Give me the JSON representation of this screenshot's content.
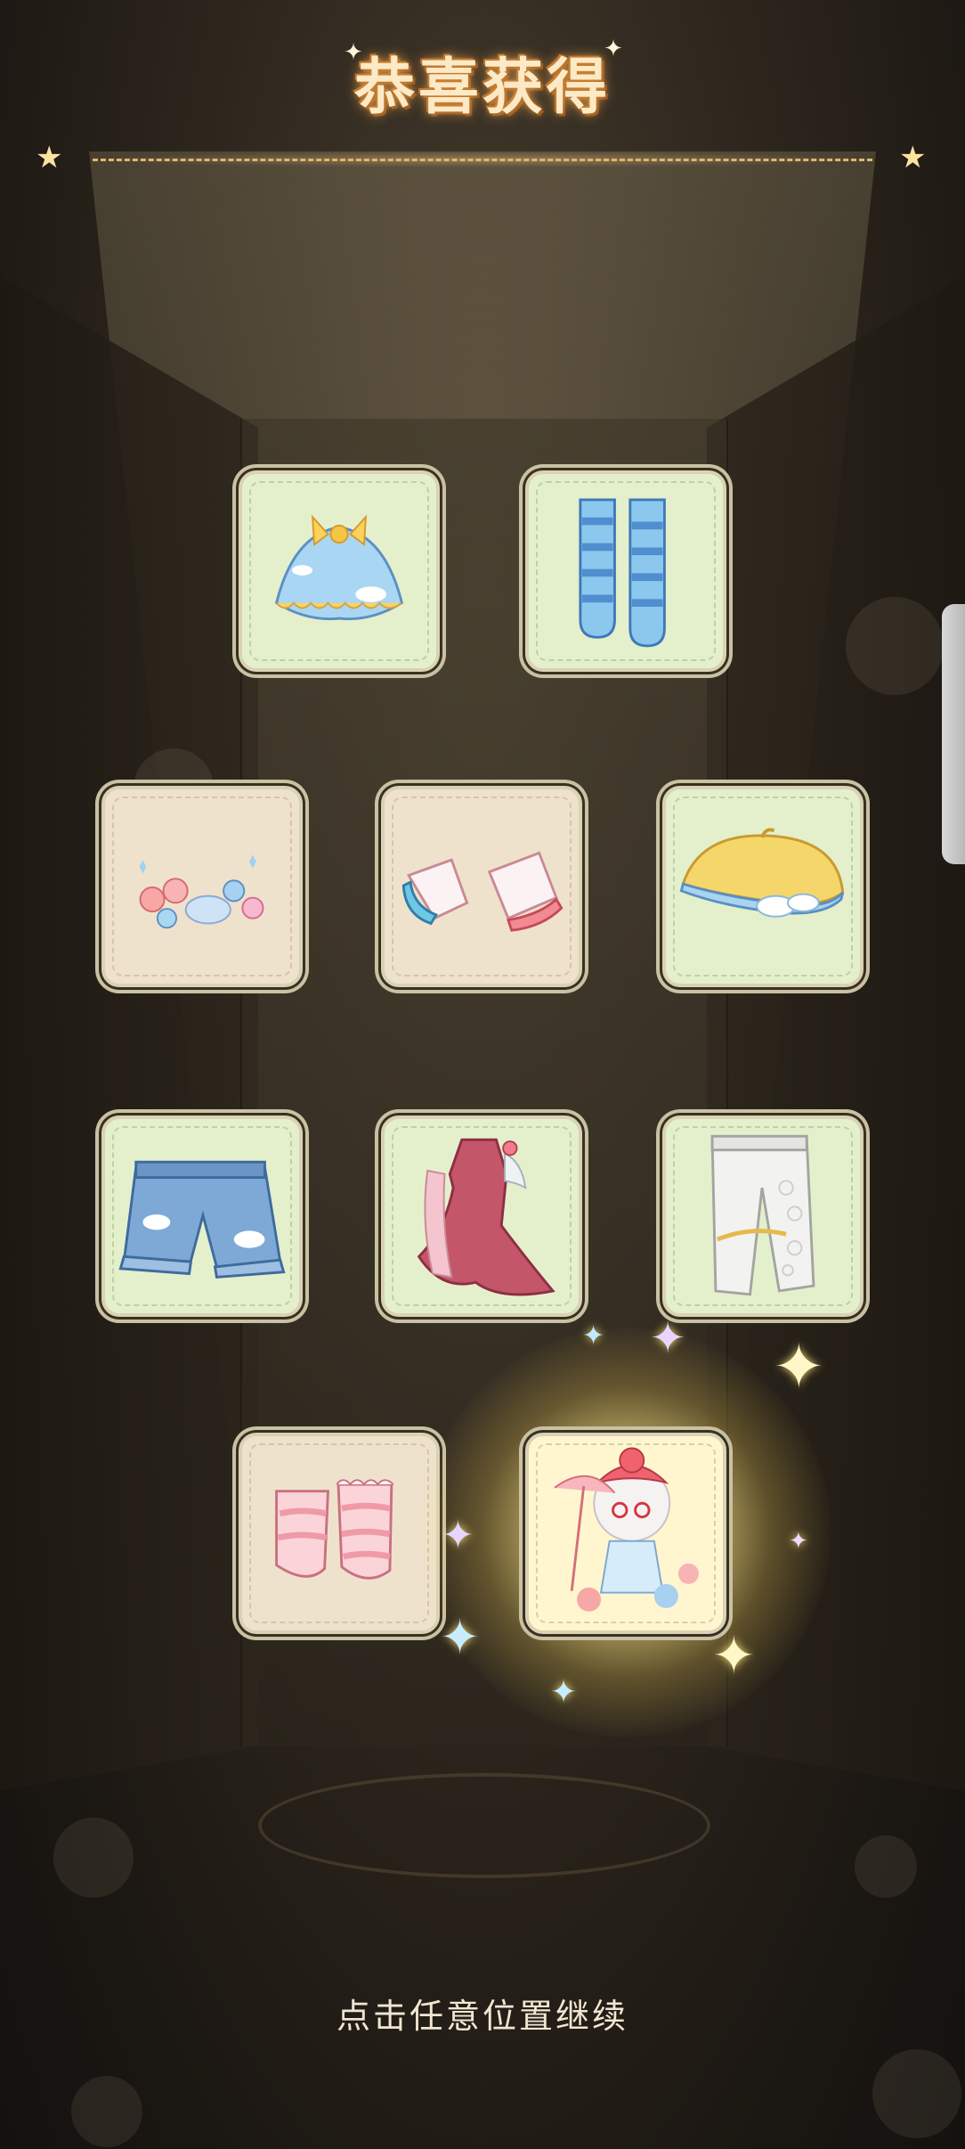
{
  "title": "恭喜获得",
  "prompt": "点击任意位置继续",
  "colors": {
    "title": "#fce9c6",
    "divider": "#e3b56c",
    "card_green": "#e4f0cc",
    "card_beige": "#efe2cc"
  },
  "rewards": [
    {
      "name": "cloud-raincoat-cape",
      "bg": "green",
      "icon": "cape-icon"
    },
    {
      "name": "blue-striped-stockings",
      "bg": "green",
      "icon": "stockings-icon"
    },
    {
      "name": "peach-hair-accessory",
      "bg": "beige",
      "icon": "hair-accessory-icon"
    },
    {
      "name": "pink-cuffs",
      "bg": "beige",
      "icon": "cuffs-icon"
    },
    {
      "name": "yellow-cloud-beret",
      "bg": "green",
      "icon": "beret-icon"
    },
    {
      "name": "denim-shorts",
      "bg": "green",
      "icon": "shorts-icon"
    },
    {
      "name": "pink-qipao-dress",
      "bg": "green",
      "icon": "dress-icon"
    },
    {
      "name": "white-lace-pants",
      "bg": "green",
      "icon": "pants-icon"
    },
    {
      "name": "pink-leg-warmers",
      "bg": "beige",
      "icon": "leg-warmers-icon"
    },
    {
      "name": "character-peach-outfit",
      "bg": "green",
      "icon": "character-icon",
      "highlighted": true
    }
  ]
}
